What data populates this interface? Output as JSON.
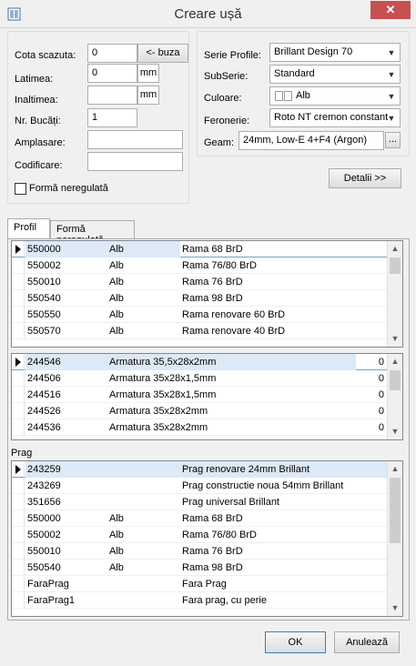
{
  "window": {
    "title": "Creare ușă",
    "close_label": "✕"
  },
  "left_form": {
    "cota_label": "Cota scazuta:",
    "cota_value": "0",
    "buza_button": "<- buza",
    "latimea_label": "Latimea:",
    "latimea_value": "0",
    "latimea_unit": "mm",
    "inaltimea_label": "Inaltimea:",
    "inaltimea_value": "",
    "inaltimea_unit": "mm",
    "nr_bucati_label": "Nr. Bucăți:",
    "nr_bucati_value": "1",
    "amplasare_label": "Amplasare:",
    "amplasare_value": "",
    "codificare_label": "Codificare:",
    "codificare_value": "",
    "forma_neregulata_label": "Formă neregulată",
    "forma_neregulata_checked": false
  },
  "right_form": {
    "serie_label": "Serie Profile:",
    "serie_value": "Brillant Design 70",
    "subserie_label": "SubSerie:",
    "subserie_value": "Standard",
    "culoare_label": "Culoare:",
    "culoare_value": "Alb",
    "feronerie_label": "Feronerie:",
    "feronerie_value": "Roto NT cremon constant",
    "geam_label": "Geam:",
    "geam_value": "24mm, Low-E 4+F4 (Argon)",
    "geam_button": "..."
  },
  "detalii_button": "Detalii >>",
  "tabs": [
    {
      "label": "Profil"
    },
    {
      "label": "Formă neregulată"
    }
  ],
  "profil_grid": {
    "rows": [
      {
        "code": "550000",
        "color": "Alb",
        "name": "Rama 68 BrD"
      },
      {
        "code": "550002",
        "color": "Alb",
        "name": "Rama 76/80 BrD"
      },
      {
        "code": "550010",
        "color": "Alb",
        "name": "Rama 76 BrD"
      },
      {
        "code": "550540",
        "color": "Alb",
        "name": "Rama 98 BrD"
      },
      {
        "code": "550550",
        "color": "Alb",
        "name": "Rama renovare 60 BrD"
      },
      {
        "code": "550570",
        "color": "Alb",
        "name": "Rama renovare 40 BrD"
      }
    ]
  },
  "armatura_grid": {
    "rows": [
      {
        "code": "244546",
        "name": "Armatura 35,5x28x2mm",
        "qty": "0"
      },
      {
        "code": "244506",
        "name": "Armatura 35x28x1,5mm",
        "qty": "0"
      },
      {
        "code": "244516",
        "name": "Armatura 35x28x1,5mm",
        "qty": "0"
      },
      {
        "code": "244526",
        "name": "Armatura 35x28x2mm",
        "qty": "0"
      },
      {
        "code": "244536",
        "name": "Armatura 35x28x2mm",
        "qty": "0"
      }
    ]
  },
  "prag_label": "Prag",
  "prag_grid": {
    "rows": [
      {
        "code": "243259",
        "color": "",
        "name": "Prag renovare 24mm Brillant"
      },
      {
        "code": "243269",
        "color": "",
        "name": "Prag constructie noua 54mm Brillant"
      },
      {
        "code": "351656",
        "color": "",
        "name": "Prag universal Brillant"
      },
      {
        "code": "550000",
        "color": "Alb",
        "name": "Rama 68 BrD"
      },
      {
        "code": "550002",
        "color": "Alb",
        "name": "Rama 76/80 BrD"
      },
      {
        "code": "550010",
        "color": "Alb",
        "name": "Rama 76 BrD"
      },
      {
        "code": "550540",
        "color": "Alb",
        "name": "Rama 98 BrD"
      },
      {
        "code": "FaraPrag",
        "color": "",
        "name": "Fara Prag"
      },
      {
        "code": "FaraPrag1",
        "color": "",
        "name": "Fara prag, cu perie"
      }
    ]
  },
  "ok_button": "OK",
  "cancel_button": "Anulează"
}
